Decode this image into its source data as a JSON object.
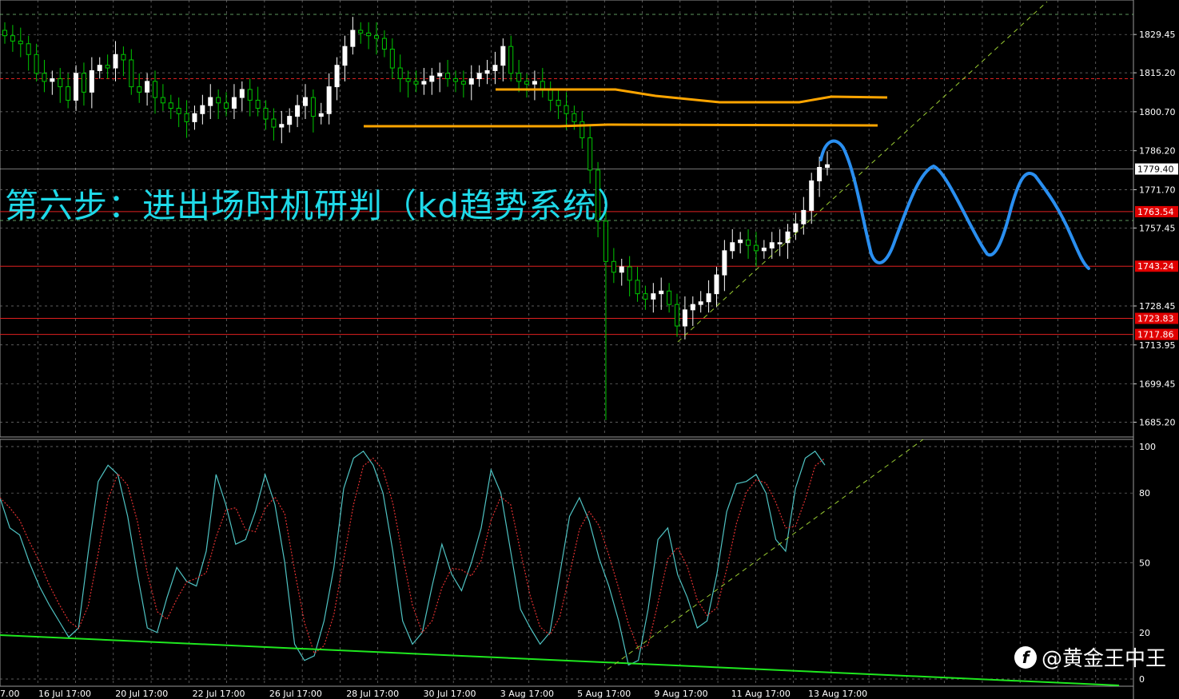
{
  "overlay_title": "第六步：进出场时机研判（kd趋势系统）",
  "watermark": {
    "logo": "f",
    "text": "@黄金王中王"
  },
  "colors": {
    "background": "#000000",
    "grid": "#7a7a7a",
    "bull_candle": "#ffffff",
    "bear_candle": "#00c800",
    "price_line": "#ffffff",
    "support_lines": "#e02020",
    "orange_lines": "#ffa500",
    "blue_projection": "#2a8ff0",
    "k_line": "#4fc3c3",
    "d_line": "#e03030",
    "trend_green": "#1fe81f",
    "trend_dashed": "#9acd32"
  },
  "chart_data": [
    {
      "type": "candlestick",
      "name": "price",
      "x_labels": [
        "7.00",
        "16 Jul 17:00",
        "20 Jul 17:00",
        "22 Jul 17:00",
        "26 Jul 17:00",
        "28 Jul 17:00",
        "30 Jul 17:00",
        "3 Aug 17:00",
        "5 Aug 17:00",
        "9 Aug 17:00",
        "11 Aug 17:00",
        "13 Aug 17:00"
      ],
      "y_ticks": [
        1829.45,
        1815.2,
        1800.7,
        1786.2,
        1771.7,
        1757.45,
        1728.45,
        1713.95,
        1699.45,
        1685.2
      ],
      "ylim": [
        1680.0,
        1840.5
      ],
      "current_price": 1779.4,
      "price_labels": [
        1763.54,
        1743.24,
        1723.83,
        1717.86
      ],
      "close_series": [
        1829,
        1827,
        1826,
        1822,
        1815,
        1812,
        1813,
        1810,
        1805,
        1815,
        1808,
        1816,
        1818,
        1817,
        1822,
        1820,
        1810,
        1808,
        1812,
        1806,
        1804,
        1802,
        1800,
        1797,
        1800,
        1803,
        1806,
        1804,
        1802,
        1806,
        1809,
        1805,
        1802,
        1798,
        1795,
        1796,
        1799,
        1803,
        1806,
        1799,
        1800,
        1810,
        1818,
        1825,
        1831,
        1830,
        1829,
        1828,
        1824,
        1817,
        1813,
        1812,
        1811,
        1812,
        1814,
        1815,
        1813,
        1812,
        1811,
        1813,
        1815,
        1816,
        1818,
        1825,
        1815,
        1812,
        1811,
        1812,
        1809,
        1805,
        1803,
        1800,
        1797,
        1791,
        1779,
        1760,
        1745,
        1741,
        1743,
        1738,
        1733,
        1731,
        1733,
        1734,
        1729,
        1721,
        1727,
        1729,
        1730,
        1733,
        1740,
        1749,
        1752,
        1753,
        1751,
        1749,
        1750,
        1752,
        1752,
        1756,
        1759,
        1764,
        1775,
        1780,
        1781
      ],
      "horizontal_lines": [
        1743.24,
        1723.83,
        1717.86,
        1763.54
      ]
    },
    {
      "type": "line",
      "name": "stochastic",
      "y_ticks": [
        100,
        80,
        50,
        20,
        0
      ],
      "ylim": [
        0,
        100
      ],
      "k_values": [
        78,
        65,
        62,
        50,
        40,
        32,
        25,
        18,
        22,
        55,
        85,
        92,
        88,
        70,
        45,
        22,
        20,
        35,
        48,
        42,
        40,
        55,
        88,
        75,
        58,
        60,
        72,
        88,
        75,
        50,
        15,
        8,
        10,
        25,
        48,
        82,
        95,
        98,
        92,
        80,
        55,
        25,
        15,
        20,
        40,
        58,
        45,
        38,
        50,
        65,
        90,
        80,
        55,
        30,
        22,
        15,
        20,
        45,
        70,
        78,
        68,
        52,
        40,
        25,
        6,
        8,
        30,
        60,
        65,
        45,
        35,
        22,
        25,
        45,
        72,
        84,
        85,
        88,
        80,
        60,
        55,
        82,
        95,
        98,
        92
      ]
    }
  ]
}
